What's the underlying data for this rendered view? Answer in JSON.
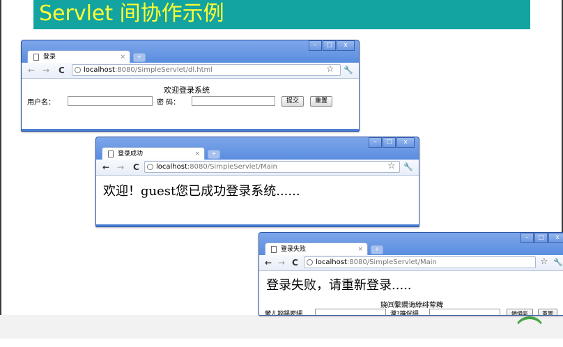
{
  "slide": {
    "title": "Servlet 间协作示例",
    "colors": {
      "title_bg": "#13a3a0",
      "title_text": "#ffff33"
    }
  },
  "browser1": {
    "tab_title": "登录",
    "url_host": "localhost",
    "url_path": ":8080/SimpleServlet/dl.html",
    "page": {
      "heading": "欢迎登录系统",
      "username_label": "用户名：",
      "password_label": "密  码：",
      "username_value": "",
      "password_value": "",
      "submit_label": "提交",
      "reset_label": "重置"
    }
  },
  "browser2": {
    "tab_title": "登录成功",
    "url_host": "localhost",
    "url_path": ":8080/SimpleServlet/Main",
    "page": {
      "message": "欢迎！guest您已成功登录系统......"
    }
  },
  "browser3": {
    "tab_title": "登录失败",
    "url_host": "localhost",
    "url_path": ":8080/SimpleServlet/Main",
    "page": {
      "message": "登录失败，请重新登录.....",
      "garbled_heading": "娆㈣繋鐧诲綍绯荤粺",
      "garbled_user_label": "鐢ㄦ埛鍚嶏細",
      "garbled_pass_label": "瀵?鐮侊細",
      "garbled_submit": "鎻愪氦",
      "reset_label": "重置"
    }
  },
  "common": {
    "icons": [
      "document-icon",
      "close-icon",
      "new-tab-icon",
      "back-arrow-icon",
      "forward-arrow-icon",
      "reload-icon",
      "globe-icon",
      "star-icon",
      "wrench-icon",
      "minimize-icon",
      "maximize-icon",
      "window-close-icon"
    ],
    "glyphs": {
      "close": "×",
      "newtab": "+",
      "back": "←",
      "forward": "→",
      "reload": "C",
      "star": "☆",
      "wrench": "🔧",
      "min": "–",
      "max": "□",
      "winclose": "x"
    }
  }
}
